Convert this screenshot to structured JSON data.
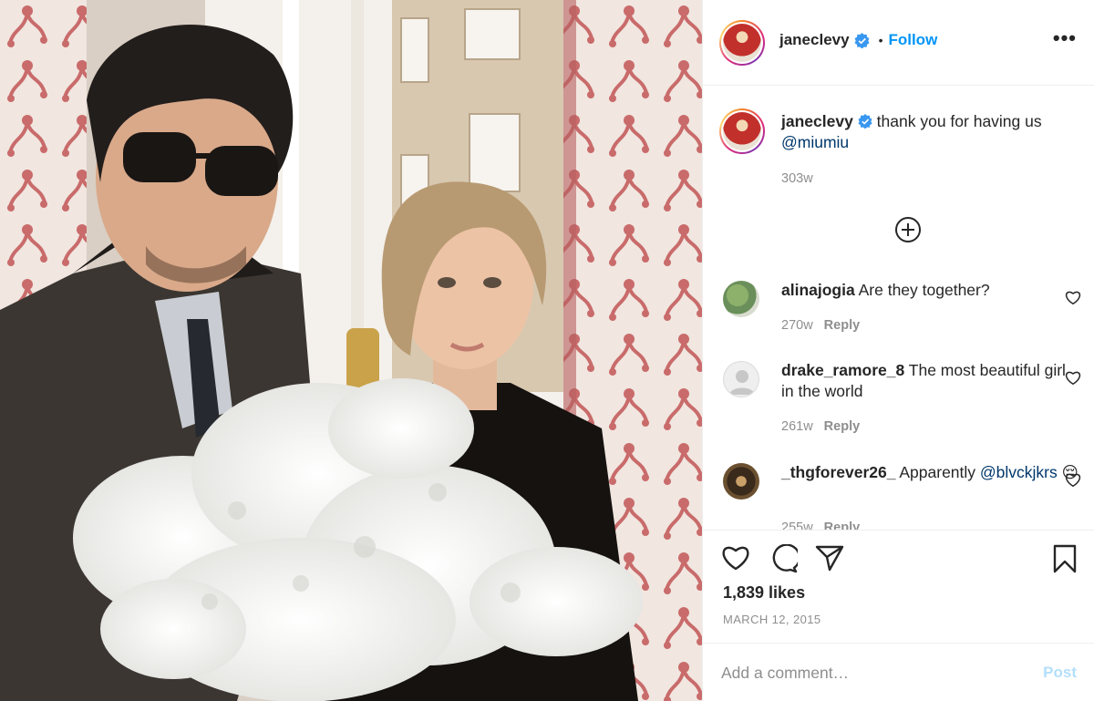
{
  "post": {
    "author": "janeclevy",
    "follow_label": "Follow",
    "dot": "•",
    "more_label": "•••"
  },
  "caption": {
    "username": "janeclevy",
    "text": " thank you for having us ",
    "mention": "@miumiu",
    "age": "303w"
  },
  "comments": [
    {
      "username": "alinajogia",
      "text": " Are they together?",
      "age": "270w",
      "reply": "Reply"
    },
    {
      "username": "drake_ramore_8",
      "text": " The most beautiful girl in the world",
      "age": "261w",
      "reply": "Reply"
    },
    {
      "username": "_thgforever26_",
      "text": " Apparently ",
      "mention": "@blvckjkrs",
      "emoji": "😔",
      "age": "255w",
      "reply": "Reply"
    }
  ],
  "engagement": {
    "likes": "1,839 likes",
    "date": "MARCH 12, 2015"
  },
  "add_comment": {
    "placeholder": "Add a comment…",
    "post_label": "Post"
  },
  "icons": [
    "verified-badge-icon",
    "more-options-icon",
    "load-more-comments-icon",
    "heart-icon",
    "comment-icon",
    "share-icon",
    "bookmark-icon"
  ],
  "colors": {
    "accent": "#0095f6",
    "post_disabled": "#b2dffc",
    "muted": "#8e8e8e",
    "mention": "#00376b"
  }
}
